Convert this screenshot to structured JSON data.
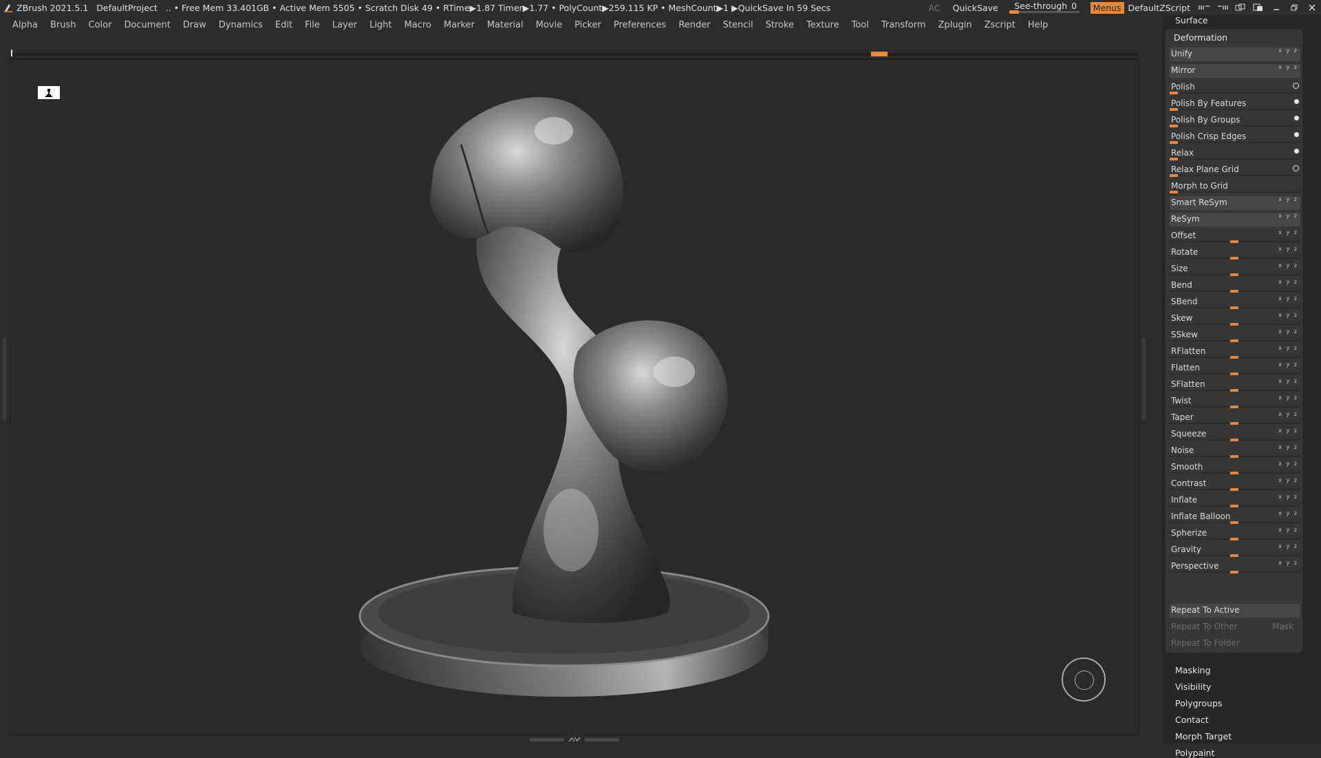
{
  "titlebar": {
    "app": "ZBrush 2021.5.1",
    "project": "DefaultProject",
    "stats": ".. • Free Mem 33.401GB • Active Mem 5505 • Scratch Disk 49 •  RTime▶1.87 Timer▶1.77 • PolyCount▶259.115 KP  • MeshCount▶1  ▶QuickSave In 59 Secs",
    "ac": "AC",
    "quicksave": "QuickSave",
    "seethrough_label": "See-through",
    "seethrough_value": "0",
    "menus": "Menus",
    "script": "DefaultZScript",
    "window_icons": [
      "toggle-icon",
      "toggle-icon",
      "layout-icon",
      "layout-icon",
      "minimize-icon",
      "restore-icon",
      "close-icon"
    ]
  },
  "menubar": [
    "Alpha",
    "Brush",
    "Color",
    "Document",
    "Draw",
    "Dynamics",
    "Edit",
    "File",
    "Layer",
    "Light",
    "Macro",
    "Marker",
    "Material",
    "Movie",
    "Picker",
    "Preferences",
    "Render",
    "Stencil",
    "Stroke",
    "Texture",
    "Tool",
    "Transform",
    "Zplugin",
    "Zscript",
    "Help"
  ],
  "panel": {
    "surface": "Surface",
    "deformation": "Deformation",
    "items": [
      {
        "label": "Unify",
        "kind": "button",
        "xyz": "x y z"
      },
      {
        "label": "Mirror",
        "kind": "button",
        "xyz": "x y z"
      },
      {
        "label": "Polish",
        "kind": "slider-left",
        "ctrl": "ring"
      },
      {
        "label": "Polish By Features",
        "kind": "slider-left",
        "ctrl": "dot"
      },
      {
        "label": "Polish By Groups",
        "kind": "slider-left",
        "ctrl": "dot"
      },
      {
        "label": "Polish Crisp Edges",
        "kind": "slider-left",
        "ctrl": "dot"
      },
      {
        "label": "Relax",
        "kind": "slider-left",
        "ctrl": "dot"
      },
      {
        "label": "Relax Plane Grid",
        "kind": "slider-left",
        "ctrl": "ring"
      },
      {
        "label": "Morph to Grid",
        "kind": "slider-left"
      },
      {
        "label": "Smart ReSym",
        "kind": "button",
        "xyz": "x y z"
      },
      {
        "label": "ReSym",
        "kind": "button",
        "xyz": "x y z"
      },
      {
        "label": "Offset",
        "kind": "slider",
        "xyz": "x y z"
      },
      {
        "label": "Rotate",
        "kind": "slider",
        "xyz": "x y z"
      },
      {
        "label": "Size",
        "kind": "slider",
        "xyz": "x y z"
      },
      {
        "label": "Bend",
        "kind": "slider",
        "xyz": "x y z"
      },
      {
        "label": "SBend",
        "kind": "slider",
        "xyz": "x y z"
      },
      {
        "label": "Skew",
        "kind": "slider",
        "xyz": "x y z"
      },
      {
        "label": "SSkew",
        "kind": "slider",
        "xyz": "x y z"
      },
      {
        "label": "RFlatten",
        "kind": "slider",
        "xyz": "x y z"
      },
      {
        "label": "Flatten",
        "kind": "slider",
        "xyz": "x y z"
      },
      {
        "label": "SFlatten",
        "kind": "slider",
        "xyz": "x y z"
      },
      {
        "label": "Twist",
        "kind": "slider",
        "xyz": "x y z"
      },
      {
        "label": "Taper",
        "kind": "slider",
        "xyz": "x y z"
      },
      {
        "label": "Squeeze",
        "kind": "slider",
        "xyz": "x y z"
      },
      {
        "label": "Noise",
        "kind": "slider",
        "xyz": "x y z"
      },
      {
        "label": "Smooth",
        "kind": "slider",
        "xyz": "x y z"
      },
      {
        "label": "Contrast",
        "kind": "slider",
        "xyz": "x y z"
      },
      {
        "label": "Inflate",
        "kind": "slider",
        "xyz": "x y z"
      },
      {
        "label": "Inflate Balloon",
        "kind": "slider",
        "xyz": "x y z"
      },
      {
        "label": "Spherize",
        "kind": "slider",
        "xyz": "x y z"
      },
      {
        "label": "Gravity",
        "kind": "slider",
        "xyz": "x y z"
      },
      {
        "label": "Perspective",
        "kind": "slider",
        "xyz": "x y z"
      }
    ],
    "repeat_active": "Repeat To Active",
    "repeat_other": "Repeat To Other",
    "mask": "Mask",
    "repeat_folder": "Repeat To Folder",
    "subpalettes": [
      "Masking",
      "Visibility",
      "Polygroups",
      "Contact",
      "Morph Target",
      "Polypaint"
    ]
  },
  "colors": {
    "accent": "#e8883b",
    "background": "#2a2a2a",
    "panel": "#363636"
  }
}
